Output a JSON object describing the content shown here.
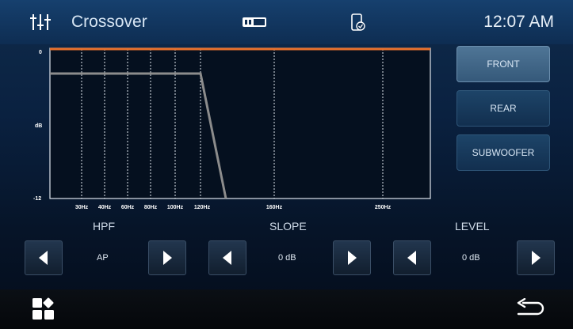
{
  "header": {
    "title": "Crossover",
    "time": "12:07 AM",
    "icons": [
      "equalizer-icon",
      "sd-card-icon",
      "phone-link-icon"
    ]
  },
  "graph": {
    "y_top": "0",
    "y_mid": "dB",
    "y_bottom": "-12",
    "x_labels": [
      "30Hz",
      "40Hz",
      "60Hz",
      "80Hz",
      "100Hz",
      "120Hz",
      "160Hz",
      "250Hz"
    ],
    "colors": {
      "flat_line": "#e8702c",
      "curve": "#8c8c8c",
      "grid": "#e0e0e0"
    }
  },
  "channels": {
    "front": "FRONT",
    "rear": "REAR",
    "subwoofer": "SUBWOOFER",
    "active": "FRONT"
  },
  "controls": {
    "hpf_label": "HPF",
    "hpf_value": "AP",
    "slope_label": "SLOPE",
    "slope_value": "0 dB",
    "level_label": "LEVEL",
    "level_value": "0 dB"
  },
  "footer": {
    "icons": [
      "apps-icon",
      "back-icon"
    ]
  }
}
